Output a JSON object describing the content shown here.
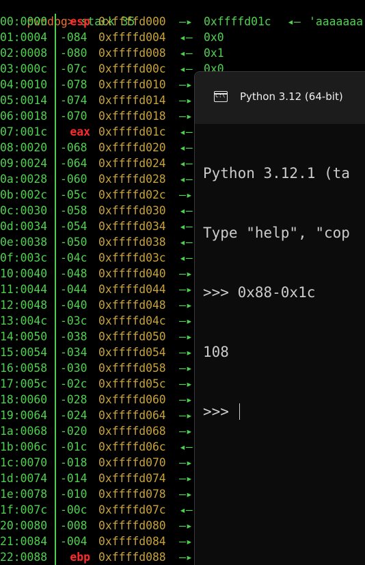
{
  "terminal": {
    "prompt": "pwndbg>",
    "command": "stack 35",
    "rows": [
      {
        "idx": "00:0000",
        "off": "esp",
        "reg": true,
        "addr": "0xffffd000",
        "arrow": "—▸",
        "val": "0xffffd01c",
        "arrow2": "◂—",
        "str": "'aaaaaaa"
      },
      {
        "idx": "01:0004",
        "off": "-084",
        "reg": false,
        "addr": "0xffffd004",
        "arrow": "◂—",
        "val": "0x0",
        "arrow2": "",
        "str": ""
      },
      {
        "idx": "02:0008",
        "off": "-080",
        "reg": false,
        "addr": "0xffffd008",
        "arrow": "◂—",
        "val": "0x1",
        "arrow2": "",
        "str": ""
      },
      {
        "idx": "03:000c",
        "off": "-07c",
        "reg": false,
        "addr": "0xffffd00c",
        "arrow": "◂—",
        "val": "0x0",
        "arrow2": "",
        "str": ""
      },
      {
        "idx": "04:0010",
        "off": "-078",
        "reg": false,
        "addr": "0xffffd010",
        "arrow": "—▸",
        "val": "",
        "arrow2": "",
        "str": ""
      },
      {
        "idx": "05:0014",
        "off": "-074",
        "reg": false,
        "addr": "0xffffd014",
        "arrow": "—▸",
        "val": "",
        "arrow2": "",
        "str": ""
      },
      {
        "idx": "06:0018",
        "off": "-070",
        "reg": false,
        "addr": "0xffffd018",
        "arrow": "—▸",
        "val": "",
        "arrow2": "",
        "str": ""
      },
      {
        "idx": "07:001c",
        "off": "eax",
        "reg": true,
        "addr": "0xffffd01c",
        "arrow": "◂—",
        "val": "",
        "arrow2": "",
        "str": ""
      },
      {
        "idx": "08:0020",
        "off": "-068",
        "reg": false,
        "addr": "0xffffd020",
        "arrow": "◂—",
        "val": "",
        "arrow2": "",
        "str": ""
      },
      {
        "idx": "09:0024",
        "off": "-064",
        "reg": false,
        "addr": "0xffffd024",
        "arrow": "◂—",
        "val": "",
        "arrow2": "",
        "str": ""
      },
      {
        "idx": "0a:0028",
        "off": "-060",
        "reg": false,
        "addr": "0xffffd028",
        "arrow": "◂—",
        "val": "",
        "arrow2": "",
        "str": ""
      },
      {
        "idx": "0b:002c",
        "off": "-05c",
        "reg": false,
        "addr": "0xffffd02c",
        "arrow": "—▸",
        "val": "",
        "arrow2": "",
        "str": ""
      },
      {
        "idx": "0c:0030",
        "off": "-058",
        "reg": false,
        "addr": "0xffffd030",
        "arrow": "◂—",
        "val": "",
        "arrow2": "",
        "str": ""
      },
      {
        "idx": "0d:0034",
        "off": "-054",
        "reg": false,
        "addr": "0xffffd034",
        "arrow": "◂—",
        "val": "",
        "arrow2": "",
        "str": ""
      },
      {
        "idx": "0e:0038",
        "off": "-050",
        "reg": false,
        "addr": "0xffffd038",
        "arrow": "◂—",
        "val": "",
        "arrow2": "",
        "str": ""
      },
      {
        "idx": "0f:003c",
        "off": "-04c",
        "reg": false,
        "addr": "0xffffd03c",
        "arrow": "◂—",
        "val": "",
        "arrow2": "",
        "str": ""
      },
      {
        "idx": "10:0040",
        "off": "-048",
        "reg": false,
        "addr": "0xffffd040",
        "arrow": "—▸",
        "val": "",
        "arrow2": "",
        "str": ""
      },
      {
        "idx": "11:0044",
        "off": "-044",
        "reg": false,
        "addr": "0xffffd044",
        "arrow": "—▸",
        "val": "",
        "arrow2": "",
        "str": ""
      },
      {
        "idx": "12:0048",
        "off": "-040",
        "reg": false,
        "addr": "0xffffd048",
        "arrow": "—▸",
        "val": "",
        "arrow2": "",
        "str": ""
      },
      {
        "idx": "13:004c",
        "off": "-03c",
        "reg": false,
        "addr": "0xffffd04c",
        "arrow": "—▸",
        "val": "",
        "arrow2": "",
        "str": ""
      },
      {
        "idx": "14:0050",
        "off": "-038",
        "reg": false,
        "addr": "0xffffd050",
        "arrow": "—▸",
        "val": "",
        "arrow2": "",
        "str": ""
      },
      {
        "idx": "15:0054",
        "off": "-034",
        "reg": false,
        "addr": "0xffffd054",
        "arrow": "—▸",
        "val": "",
        "arrow2": "",
        "str": ""
      },
      {
        "idx": "16:0058",
        "off": "-030",
        "reg": false,
        "addr": "0xffffd058",
        "arrow": "—▸",
        "val": "",
        "arrow2": "",
        "str": ""
      },
      {
        "idx": "17:005c",
        "off": "-02c",
        "reg": false,
        "addr": "0xffffd05c",
        "arrow": "—▸",
        "val": "",
        "arrow2": "",
        "str": ""
      },
      {
        "idx": "18:0060",
        "off": "-028",
        "reg": false,
        "addr": "0xffffd060",
        "arrow": "—▸",
        "val": "",
        "arrow2": "",
        "str": ""
      },
      {
        "idx": "19:0064",
        "off": "-024",
        "reg": false,
        "addr": "0xffffd064",
        "arrow": "—▸",
        "val": "",
        "arrow2": "",
        "str": ""
      },
      {
        "idx": "1a:0068",
        "off": "-020",
        "reg": false,
        "addr": "0xffffd068",
        "arrow": "—▸",
        "val": "",
        "arrow2": "",
        "str": ""
      },
      {
        "idx": "1b:006c",
        "off": "-01c",
        "reg": false,
        "addr": "0xffffd06c",
        "arrow": "◂—",
        "val": "",
        "arrow2": "",
        "str": ""
      },
      {
        "idx": "1c:0070",
        "off": "-018",
        "reg": false,
        "addr": "0xffffd070",
        "arrow": "—▸",
        "val": "",
        "arrow2": "",
        "str": ""
      },
      {
        "idx": "1d:0074",
        "off": "-014",
        "reg": false,
        "addr": "0xffffd074",
        "arrow": "—▸",
        "val": "",
        "arrow2": "",
        "str": ""
      },
      {
        "idx": "1e:0078",
        "off": "-010",
        "reg": false,
        "addr": "0xffffd078",
        "arrow": "—▸",
        "val": "",
        "arrow2": "",
        "str": ""
      },
      {
        "idx": "1f:007c",
        "off": "-00c",
        "reg": false,
        "addr": "0xffffd07c",
        "arrow": "◂—",
        "val": "",
        "arrow2": "",
        "str": ""
      },
      {
        "idx": "20:0080",
        "off": "-008",
        "reg": false,
        "addr": "0xffffd080",
        "arrow": "—▸",
        "val": "",
        "arrow2": "",
        "str": ""
      },
      {
        "idx": "21:0084",
        "off": "-004",
        "reg": false,
        "addr": "0xffffd084",
        "arrow": "—▸",
        "val": "",
        "arrow2": "",
        "str": ""
      },
      {
        "idx": "22:0088",
        "off": "ebp",
        "reg": true,
        "addr": "0xffffd088",
        "arrow": "—▸",
        "val": "",
        "arrow2": "",
        "str": ""
      }
    ]
  },
  "python_window": {
    "icon": "terminal-icon",
    "icon_glyph": "C:\\",
    "title": "Python 3.12 (64-bit)",
    "console_lines": [
      "Python 3.12.1 (ta",
      "Type \"help\", \"cop",
      ">>> 0x88-0x1c",
      "108",
      ">>> "
    ]
  },
  "colors": {
    "prompt": "#e8722c",
    "green": "#4fd14f",
    "address": "#c8a23a",
    "register": "#ff2a2a",
    "background": "#000000"
  }
}
